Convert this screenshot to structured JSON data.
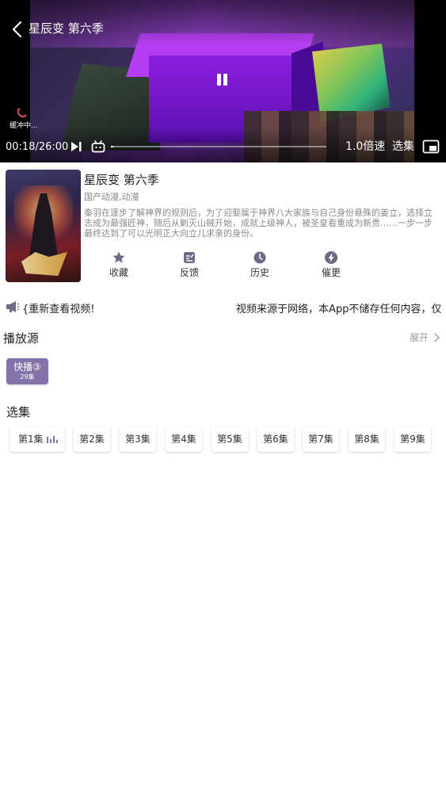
{
  "player": {
    "title": "星辰变 第六季",
    "buffering_text": "缓冲中...",
    "current_time": "00:18",
    "duration": "26:00",
    "time_display": "00:18/26:00",
    "progress_fraction": 0.0115,
    "speed_label": "1.0倍速",
    "episodes_label": "选集",
    "state": "playing",
    "icons": [
      "back-arrow-icon",
      "pause-icon",
      "next-episode-icon",
      "danmaku-tv-icon",
      "picture-in-picture-icon",
      "buffering-spinner-icon"
    ]
  },
  "info": {
    "title": "星辰变 第六季",
    "genre": "国产动漫,动漫",
    "description": "秦羽在逐步了解神界的规则后，为了迎娶属于神界八大家族与自己身份悬殊的姜立，选择立志成为最强匠神，随后从剿灭山贼开始，成就上级神人，被圣皇看重成为新贵……一步一步最终达到了可以光明正大向立儿求亲的身份。",
    "actions": [
      {
        "label": "收藏",
        "icon": "star-icon"
      },
      {
        "label": "反馈",
        "icon": "edit-note-icon"
      },
      {
        "label": "历史",
        "icon": "clock-icon"
      },
      {
        "label": "催更",
        "icon": "bolt-icon"
      }
    ]
  },
  "notice": {
    "text_a": "{重新查看视频!",
    "text_b": "视频来源于网络，本App不储存任何内容，仅提",
    "icon": "megaphone-icon"
  },
  "source": {
    "heading": "播放源",
    "expand_label": "展开",
    "items": [
      {
        "name": "快播③",
        "count": "29集"
      }
    ]
  },
  "episodes": {
    "heading": "选集",
    "items": [
      "第1集",
      "第2集",
      "第3集",
      "第4集",
      "第5集",
      "第6集",
      "第7集",
      "第8集",
      "第9集"
    ],
    "active_index": 0
  },
  "colors": {
    "accent": "#8373a8",
    "buffer": "#e04a6e"
  }
}
